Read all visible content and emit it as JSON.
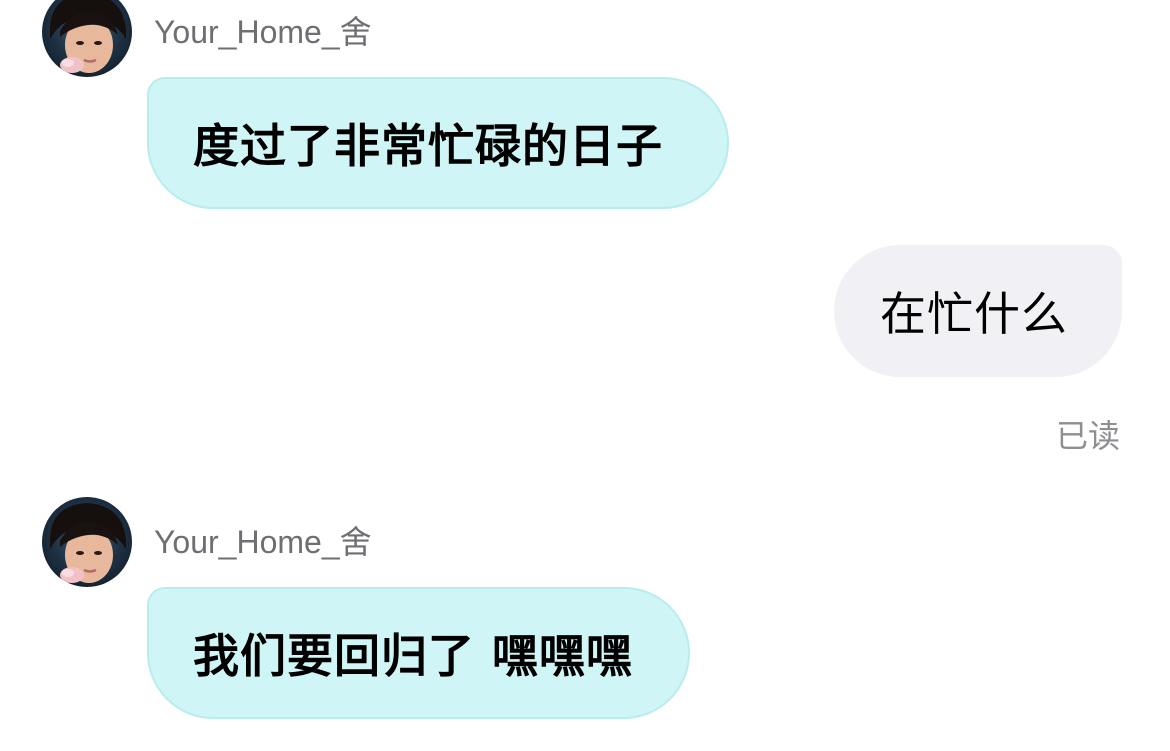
{
  "messages": [
    {
      "direction": "incoming",
      "sender": "Your_Home_舍",
      "text": "度过了非常忙碌的日子"
    },
    {
      "direction": "outgoing",
      "text": "在忙什么",
      "read_status": "已读"
    },
    {
      "direction": "incoming",
      "sender": "Your_Home_舍",
      "text": "我们要回归了 嘿嘿嘿"
    }
  ],
  "icons": {
    "avatar": "avatar-photo-icon"
  },
  "colors": {
    "incoming_bubble": "#d0f5f7",
    "incoming_bubble_border": "#b8ecef",
    "outgoing_bubble": "#f1f1f5",
    "sender_name": "#6e6e73",
    "read_status": "#8e8e93"
  }
}
